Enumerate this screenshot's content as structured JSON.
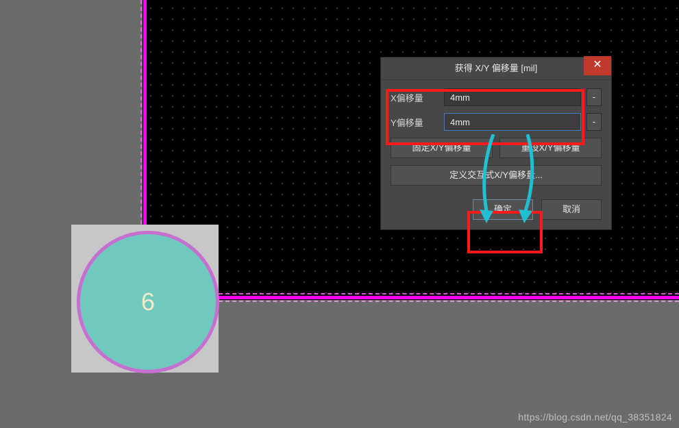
{
  "footprint": {
    "label": "6"
  },
  "dialog": {
    "title": "获得 X/Y 偏移量 [mil]",
    "close_glyph": "✕",
    "x_label": "X偏移量",
    "y_label": "Y偏移量",
    "x_value": "4mm",
    "y_value": "4mm",
    "neg_glyph": "-",
    "fix_btn": "固定X/Y偏移量",
    "reset_btn": "重设X/Y偏移量",
    "define_btn": "定义交互式X/Y偏移量...",
    "ok": "确定",
    "cancel": "取消"
  },
  "watermark": "https://blog.csdn.net/qq_38351824"
}
